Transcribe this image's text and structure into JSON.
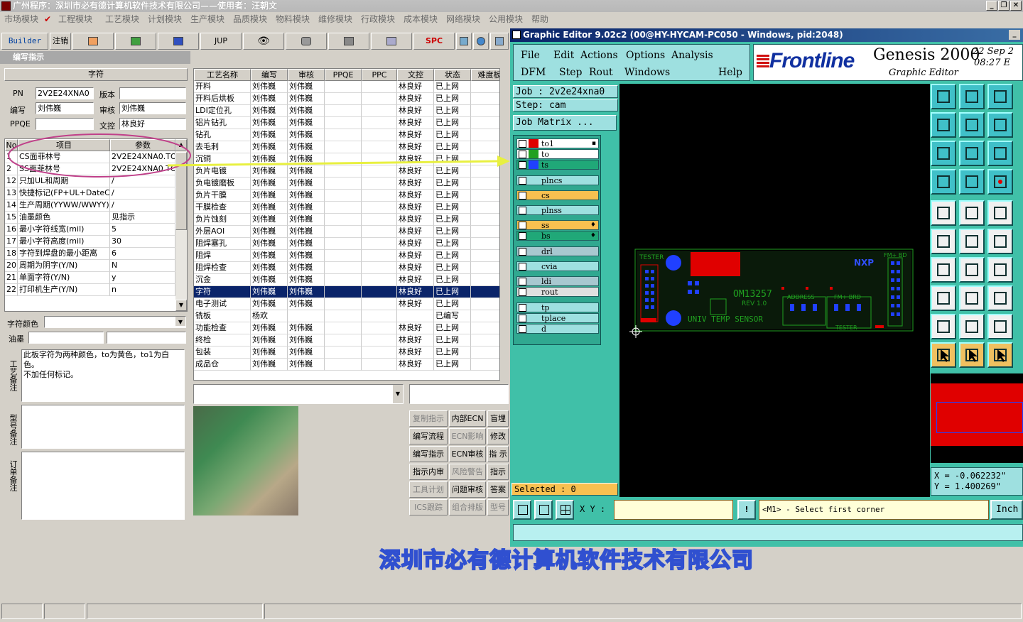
{
  "app": {
    "title": "广州程序：深圳市必有德计算机软件技术有限公司——使用者：汪朝文",
    "win_controls": [
      "_",
      "❐",
      "✕"
    ]
  },
  "menu": [
    "市场模块",
    "工程模块",
    "工艺模块",
    "计划模块",
    "生产模块",
    "品质模块",
    "物料模块",
    "维修模块",
    "行政模块",
    "成本模块",
    "网络模块",
    "公用模块",
    "帮助"
  ],
  "toolbar": {
    "builder": "Builder",
    "logout": "注销",
    "jup": "JUP",
    "spc": "SPC"
  },
  "left": {
    "section_title": "编写指示",
    "group_title": "字符",
    "pn_label": "PN",
    "pn_value": "2V2E24XNA0",
    "version_label": "版本",
    "version_value": "",
    "writer_label": "编写",
    "writer_value": "刘伟巍",
    "review_label": "审核",
    "review_value": "刘伟巍",
    "ppqe_label": "PPQE",
    "ppqe_value": "",
    "doc_label": "文控",
    "doc_value": "林良好",
    "param_headers": [
      "No",
      "项目",
      "参数"
    ],
    "params": [
      {
        "no": "1",
        "item": "CS面菲林号",
        "val": "2V2E24XNA0.TO"
      },
      {
        "no": "2",
        "item": "SS面菲林号",
        "val": "2V2E24XNA0.TO"
      },
      {
        "no": "12",
        "item": "只加UL和周期",
        "val": "/"
      },
      {
        "no": "13",
        "item": "快捷标记(FP+UL+DateCo",
        "val": "/"
      },
      {
        "no": "14",
        "item": "生产周期(YYWW/WWYY)",
        "val": "/"
      },
      {
        "no": "15",
        "item": "油墨颜色",
        "val": "见指示"
      },
      {
        "no": "16",
        "item": "最小字符线宽(mil)",
        "val": "5"
      },
      {
        "no": "17",
        "item": "最小字符高度(mil)",
        "val": "30"
      },
      {
        "no": "18",
        "item": "字符到焊盘的最小距离",
        "val": "6"
      },
      {
        "no": "20",
        "item": "周期为阴字(Y/N)",
        "val": "N"
      },
      {
        "no": "21",
        "item": "单面字符(Y/N)",
        "val": "y"
      },
      {
        "no": "22",
        "item": "打印机生产(Y/N)",
        "val": "n"
      }
    ],
    "char_color_label": "字符颜色",
    "ink_label": "油墨",
    "note1_label": "工艺备注",
    "note1_text": "此板字符为两种颜色，to为黄色，to1为白色。\n不加任何标记。",
    "note2_label": "型号备注",
    "note3_label": "订单备注"
  },
  "middle": {
    "headers": [
      "工艺名称",
      "编写",
      "审核",
      "PPQE",
      "PPC",
      "文控",
      "状态",
      "难度板"
    ],
    "rows": [
      [
        "开料",
        "刘伟巍",
        "刘伟巍",
        "",
        "",
        "林良好",
        "已上网"
      ],
      [
        "开料后烘板",
        "刘伟巍",
        "刘伟巍",
        "",
        "",
        "林良好",
        "已上网"
      ],
      [
        "LDI定位孔",
        "刘伟巍",
        "刘伟巍",
        "",
        "",
        "林良好",
        "已上网"
      ],
      [
        "铝片钻孔",
        "刘伟巍",
        "刘伟巍",
        "",
        "",
        "林良好",
        "已上网"
      ],
      [
        "钻孔",
        "刘伟巍",
        "刘伟巍",
        "",
        "",
        "林良好",
        "已上网"
      ],
      [
        "去毛刺",
        "刘伟巍",
        "刘伟巍",
        "",
        "",
        "林良好",
        "已上网"
      ],
      [
        "沉铜",
        "刘伟巍",
        "刘伟巍",
        "",
        "",
        "林良好",
        "已上网"
      ],
      [
        "负片电镀",
        "刘伟巍",
        "刘伟巍",
        "",
        "",
        "林良好",
        "已上网"
      ],
      [
        "负电镀磨板",
        "刘伟巍",
        "刘伟巍",
        "",
        "",
        "林良好",
        "已上网"
      ],
      [
        "负片干膜",
        "刘伟巍",
        "刘伟巍",
        "",
        "",
        "林良好",
        "已上网"
      ],
      [
        "干膜检查",
        "刘伟巍",
        "刘伟巍",
        "",
        "",
        "林良好",
        "已上网"
      ],
      [
        "负片蚀刻",
        "刘伟巍",
        "刘伟巍",
        "",
        "",
        "林良好",
        "已上网"
      ],
      [
        "外层AOI",
        "刘伟巍",
        "刘伟巍",
        "",
        "",
        "林良好",
        "已上网"
      ],
      [
        "阻焊塞孔",
        "刘伟巍",
        "刘伟巍",
        "",
        "",
        "林良好",
        "已上网"
      ],
      [
        "阻焊",
        "刘伟巍",
        "刘伟巍",
        "",
        "",
        "林良好",
        "已上网"
      ],
      [
        "阻焊检查",
        "刘伟巍",
        "刘伟巍",
        "",
        "",
        "林良好",
        "已上网"
      ],
      [
        "沉金",
        "刘伟巍",
        "刘伟巍",
        "",
        "",
        "林良好",
        "已上网"
      ],
      [
        "字符",
        "刘伟巍",
        "刘伟巍",
        "",
        "",
        "林良好",
        "已上网"
      ],
      [
        "电子测试",
        "刘伟巍",
        "刘伟巍",
        "",
        "",
        "林良好",
        "已上网"
      ],
      [
        "铣板",
        "杨欢",
        "",
        "",
        "",
        "",
        "已编写"
      ],
      [
        "功能检查",
        "刘伟巍",
        "刘伟巍",
        "",
        "",
        "林良好",
        "已上网"
      ],
      [
        "终检",
        "刘伟巍",
        "刘伟巍",
        "",
        "",
        "林良好",
        "已上网"
      ],
      [
        "包装",
        "刘伟巍",
        "刘伟巍",
        "",
        "",
        "林良好",
        "已上网"
      ],
      [
        "成品仓",
        "刘伟巍",
        "刘伟巍",
        "",
        "",
        "林良好",
        "已上网"
      ]
    ],
    "buttons": [
      [
        "复制指示",
        "内部ECN",
        "盲埋"
      ],
      [
        "编写流程",
        "ECN影响",
        "修改"
      ],
      [
        "编写指示",
        "ECN审核",
        "指 示"
      ],
      [
        "指示内审",
        "风险警告",
        "指示"
      ],
      [
        "工具计划",
        "问题审核",
        "答案"
      ],
      [
        "ICS跟踪",
        "组合排版",
        "型号"
      ]
    ]
  },
  "genesis": {
    "title": "Graphic Editor 9.02c2 (00@HY-HYCAM-PC050 - Windows, pid:2048)",
    "menu_row1": [
      "File",
      "Edit",
      "Actions",
      "Options",
      "Analysis"
    ],
    "menu_row2": [
      "DFM",
      "Step",
      "Rout",
      "Windows",
      "Help"
    ],
    "brand": "Frontline",
    "product": "Genesis 2000",
    "subtitle": "Graphic Editor",
    "date": "22 Sep 2",
    "time": "08:27 E",
    "job": "Job : 2v2e24xna0",
    "step": "Step: cam",
    "job_matrix": "Job Matrix ...",
    "layers": [
      {
        "name": "to1",
        "color": "#e00000",
        "bg": "#ffffff",
        "tag": "▪"
      },
      {
        "name": "to",
        "color": "#20a020",
        "bg": "#ffffff",
        "tag": ""
      },
      {
        "name": "ts",
        "color": "#2040ff",
        "bg": "#20a878",
        "tag": ""
      },
      {
        "name": "plncs",
        "color": "",
        "bg": "#9ee0e0",
        "tag": ""
      },
      {
        "name": "cs",
        "color": "",
        "bg": "#f8c050",
        "tag": ""
      },
      {
        "name": "plnss",
        "color": "",
        "bg": "#9ee0e0",
        "tag": ""
      },
      {
        "name": "ss",
        "color": "",
        "bg": "#f8c050",
        "tag": "♦"
      },
      {
        "name": "bs",
        "color": "",
        "bg": "#20a878",
        "tag": "♦"
      },
      {
        "name": "drl",
        "color": "",
        "bg": "#a8c8d0",
        "tag": ""
      },
      {
        "name": "cvia",
        "color": "",
        "bg": "#9ee0e0",
        "tag": ""
      },
      {
        "name": "ldi",
        "color": "",
        "bg": "#a8c8d0",
        "tag": ""
      },
      {
        "name": "rout",
        "color": "",
        "bg": "#e0e0e0",
        "tag": ""
      },
      {
        "name": "tp",
        "color": "",
        "bg": "#9ee0e0",
        "tag": ""
      },
      {
        "name": "tplace",
        "color": "",
        "bg": "#9ee0e0",
        "tag": ""
      },
      {
        "name": "d",
        "color": "",
        "bg": "#9ee0e0",
        "tag": ""
      }
    ],
    "selected": "Selected : 0",
    "xy_label": "X Y :",
    "xy_value": "",
    "prompt": "<M1> - Select first corner",
    "units": "Inch",
    "coord_x": "X = -0.062232\"",
    "coord_y": "Y = 1.400269\"",
    "pcb_text": {
      "tester": "TESTER",
      "part": "OM13257",
      "rev": "REV 1.0",
      "label": "UNIV TEMP SENSOR",
      "address": "ADDRESS",
      "fm_brd": "FM+ BRD",
      "tester2": "TESTER",
      "fm_bd": "FM+ BD"
    }
  },
  "footer_company": "深圳市必有德计算机软件技术有限公司",
  "colors": {
    "accent_teal": "#40c0a8",
    "selection": "#0a246a",
    "arrow": "#e8f040",
    "ellipse": "#c0408a"
  }
}
